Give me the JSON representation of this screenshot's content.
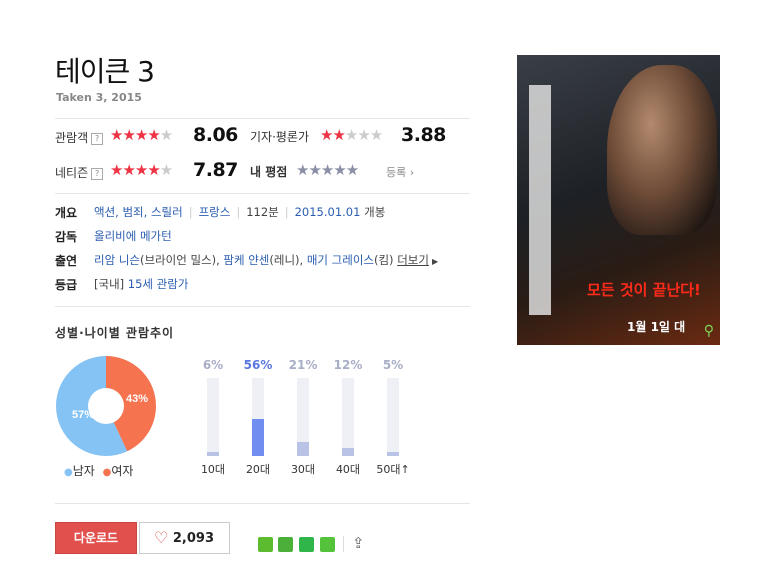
{
  "movie": {
    "title": "테이큰 3",
    "subtitle": "Taken 3, 2015"
  },
  "ratings": {
    "audience": {
      "label": "관람객",
      "stars_filled": 4,
      "score": "8.06"
    },
    "critics": {
      "label": "기자·평론가",
      "stars_filled": 2,
      "score": "3.88"
    },
    "netizen": {
      "label": "네티즌",
      "stars_filled": 4,
      "score": "7.87"
    },
    "my": {
      "label": "내 평점",
      "link": "등록"
    }
  },
  "info": {
    "overview_label": "개요",
    "genres": "액션, 범죄, 스릴러",
    "country": "프랑스",
    "runtime": "112분",
    "release": "2015.01.01",
    "release_suffix": " 개봉",
    "director_label": "감독",
    "director": "올리비에 메가턴",
    "cast_label": "출연",
    "cast1_name": "리암 니슨",
    "cast1_role": "(브라이언 밀스), ",
    "cast2_name": "팜케 얀센",
    "cast2_role": "(레니), ",
    "cast3_name": "매기 그레이스",
    "cast3_role": "(킴) ",
    "more": "더보기",
    "grade_label": "등급",
    "grade_prefix": "[국내] ",
    "grade": "15세 관람가"
  },
  "trend": {
    "title": "성별·나이별 관람추이",
    "male_pct": 57,
    "female_pct": 43,
    "male_label": "57%",
    "female_label": "43%",
    "legend_male": "남자",
    "legend_female": "여자",
    "male_color": "#86c3f5",
    "female_color": "#f5734f",
    "ages": [
      {
        "label": "10대",
        "pct_text": "6%",
        "value": 6
      },
      {
        "label": "20대",
        "pct_text": "56%",
        "value": 56,
        "highlight": true
      },
      {
        "label": "30대",
        "pct_text": "21%",
        "value": 21
      },
      {
        "label": "40대",
        "pct_text": "12%",
        "value": 12
      },
      {
        "label": "50대",
        "pct_text": "5%",
        "value": 5
      }
    ]
  },
  "actions": {
    "download": "다운로드",
    "likes": "2,093"
  },
  "poster": {
    "main_text": "모든 것이 끝난다!",
    "date_text": "1월 1일 대"
  }
}
